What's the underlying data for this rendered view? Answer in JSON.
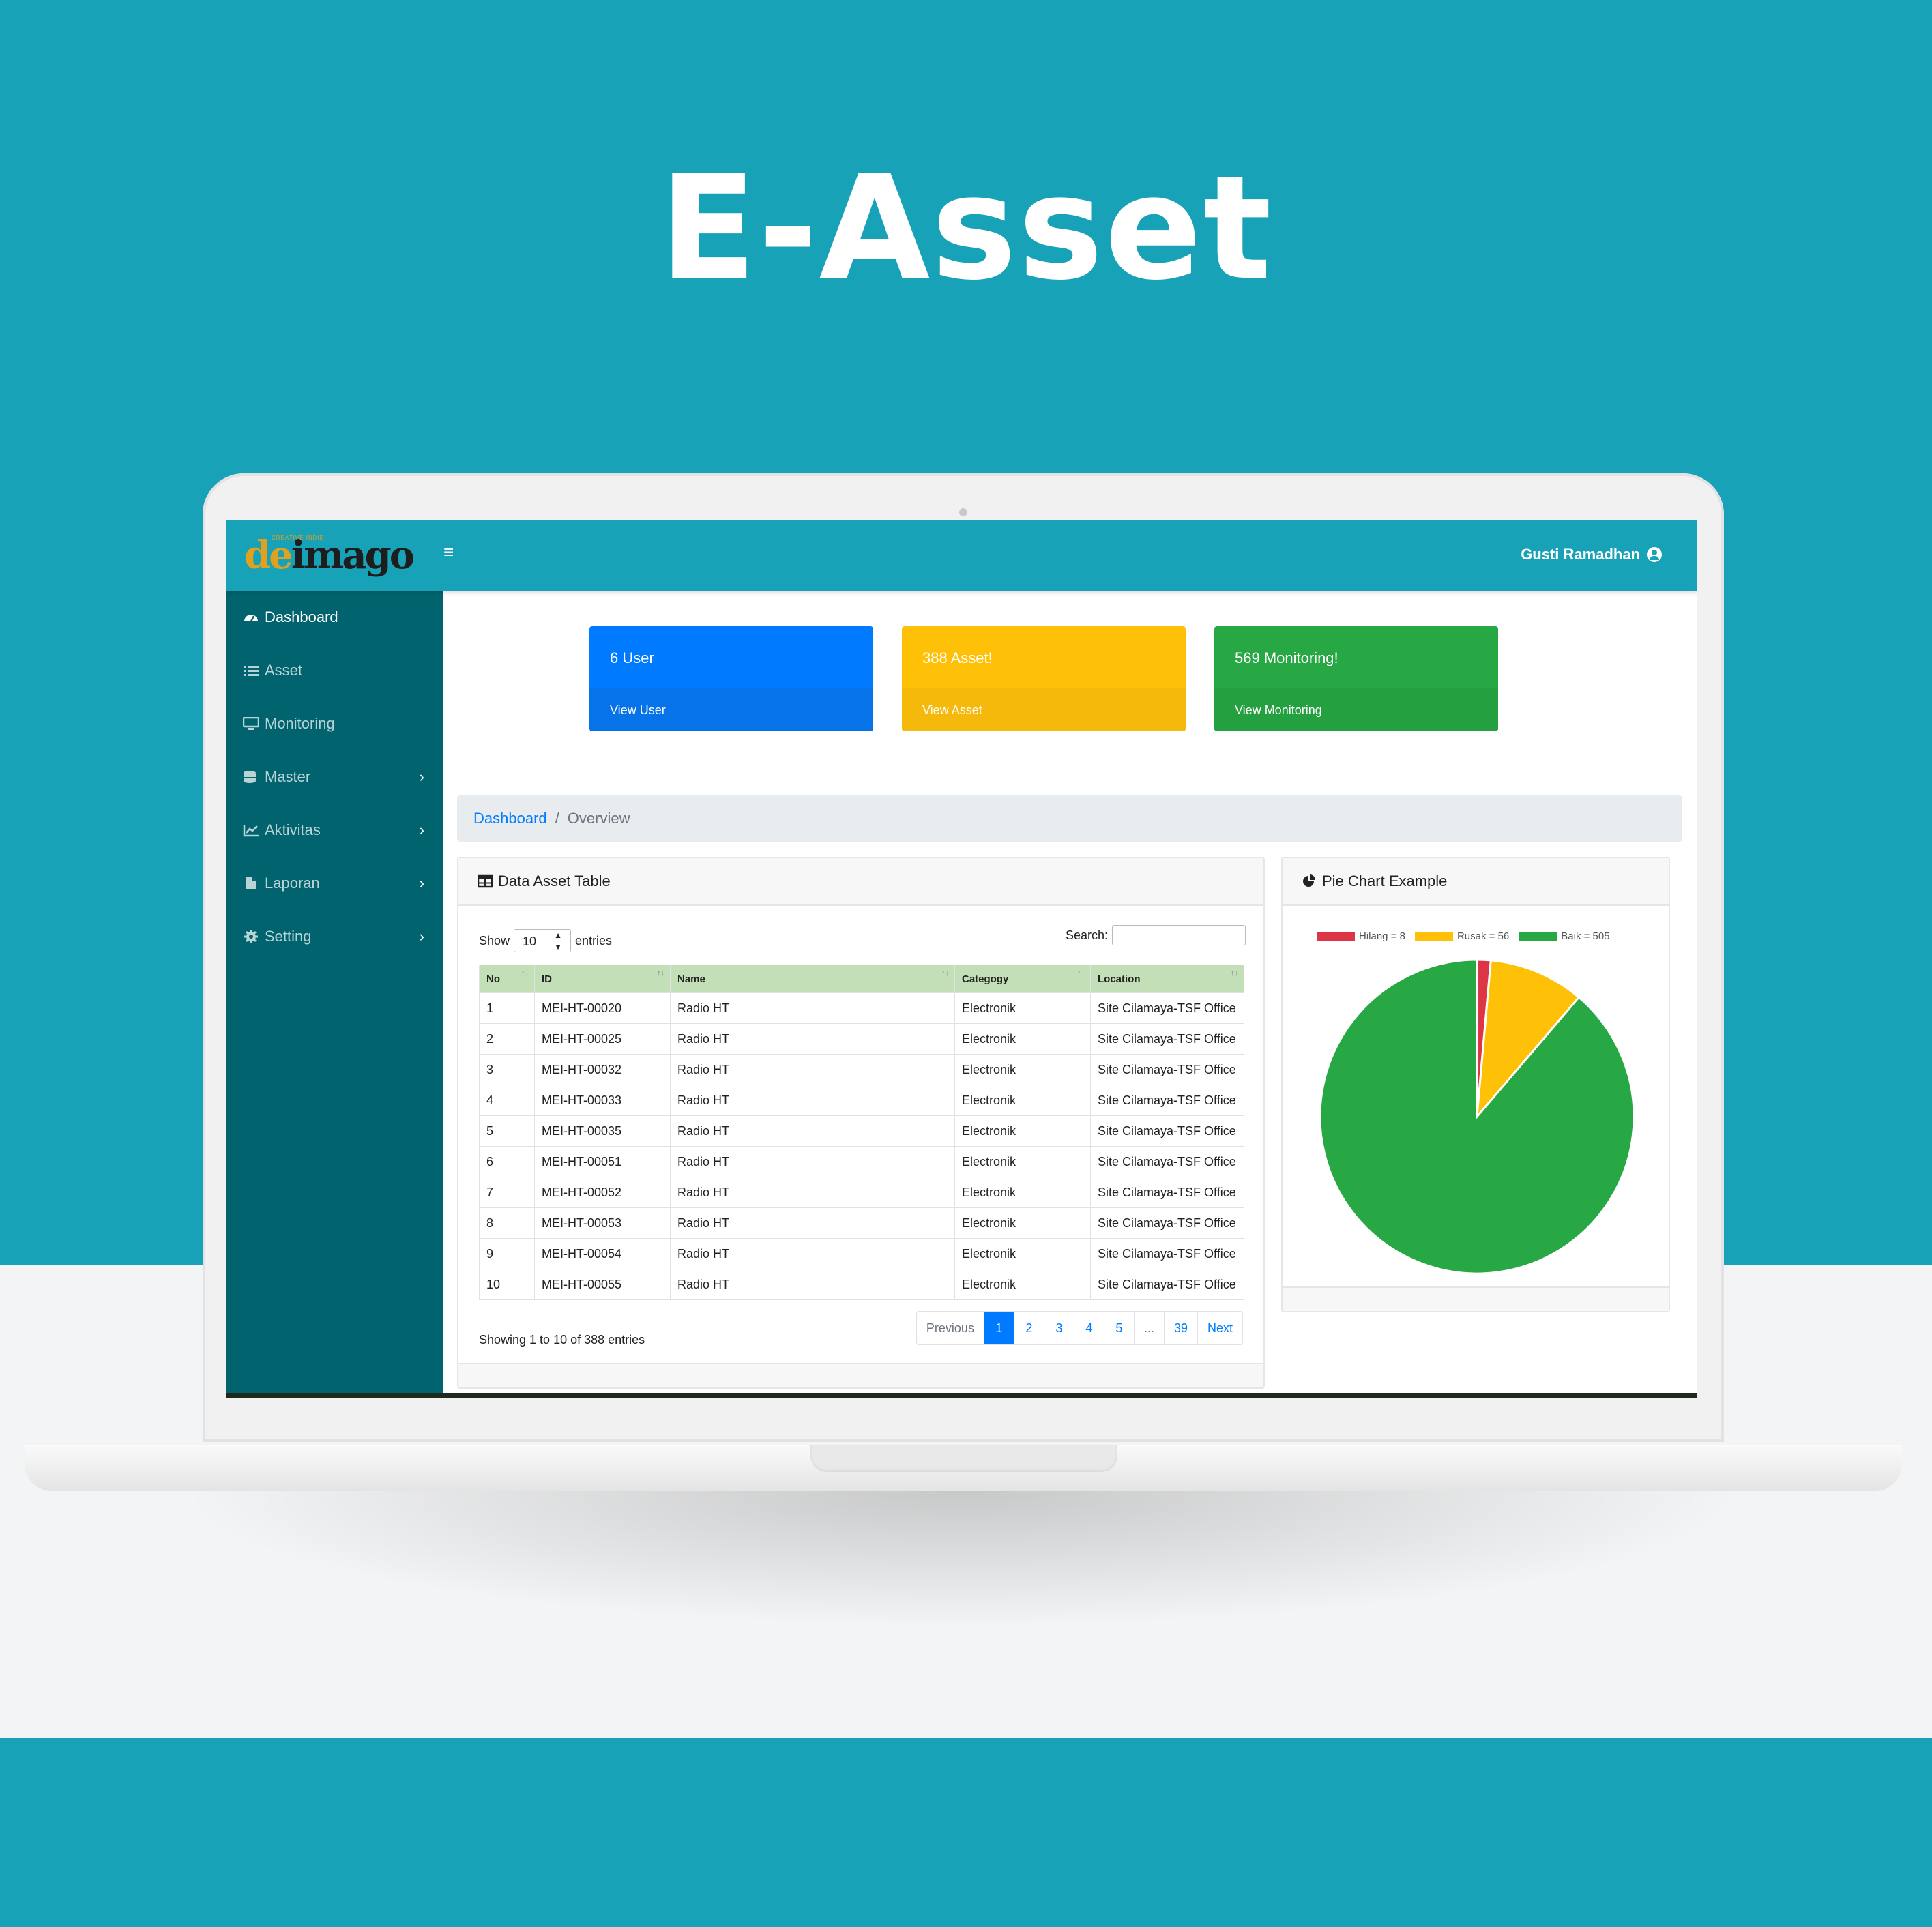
{
  "hero": {
    "title": "E-Asset"
  },
  "topbar": {
    "logo": {
      "de": "de",
      "rest": "imago",
      "tagline": "CREATIVE INDIE"
    },
    "menu_icon": "hamburger-icon",
    "user_name": "Gusti Ramadhan",
    "user_icon": "user-circle-icon"
  },
  "sidebar": {
    "items": [
      {
        "label": "Dashboard",
        "icon": "tachometer-icon",
        "active": true
      },
      {
        "label": "Asset",
        "icon": "list-icon"
      },
      {
        "label": "Monitoring",
        "icon": "desktop-icon"
      },
      {
        "label": "Master",
        "icon": "database-icon",
        "has_children": true
      },
      {
        "label": "Aktivitas",
        "icon": "line-chart-icon",
        "has_children": true
      },
      {
        "label": "Laporan",
        "icon": "file-icon",
        "has_children": true
      },
      {
        "label": "Setting",
        "icon": "gear-icon",
        "has_children": true
      }
    ]
  },
  "cards": [
    {
      "title": "6 User",
      "link": "View User",
      "color": "#007bff"
    },
    {
      "title": "388 Asset!",
      "link": "View Asset",
      "color": "#ffc107"
    },
    {
      "title": "569 Monitoring!",
      "link": "View Monitoring",
      "color": "#28a745"
    }
  ],
  "breadcrumb": {
    "link": "Dashboard",
    "separator": "/",
    "current": "Overview"
  },
  "table_card": {
    "title": "Data Asset Table",
    "icon": "table-icon",
    "show_label": "Show",
    "entries_value": "10",
    "entries_label": "entries",
    "search_label": "Search:",
    "search_value": "",
    "columns": [
      "No",
      "ID",
      "Name",
      "Categogy",
      "Location"
    ],
    "rows": [
      [
        "1",
        "MEI-HT-00020",
        "Radio HT",
        "Electronik",
        "Site Cilamaya-TSF Office"
      ],
      [
        "2",
        "MEI-HT-00025",
        "Radio HT",
        "Electronik",
        "Site Cilamaya-TSF Office"
      ],
      [
        "3",
        "MEI-HT-00032",
        "Radio HT",
        "Electronik",
        "Site Cilamaya-TSF Office"
      ],
      [
        "4",
        "MEI-HT-00033",
        "Radio HT",
        "Electronik",
        "Site Cilamaya-TSF Office"
      ],
      [
        "5",
        "MEI-HT-00035",
        "Radio HT",
        "Electronik",
        "Site Cilamaya-TSF Office"
      ],
      [
        "6",
        "MEI-HT-00051",
        "Radio HT",
        "Electronik",
        "Site Cilamaya-TSF Office"
      ],
      [
        "7",
        "MEI-HT-00052",
        "Radio HT",
        "Electronik",
        "Site Cilamaya-TSF Office"
      ],
      [
        "8",
        "MEI-HT-00053",
        "Radio HT",
        "Electronik",
        "Site Cilamaya-TSF Office"
      ],
      [
        "9",
        "MEI-HT-00054",
        "Radio HT",
        "Electronik",
        "Site Cilamaya-TSF Office"
      ],
      [
        "10",
        "MEI-HT-00055",
        "Radio HT",
        "Electronik",
        "Site Cilamaya-TSF Office"
      ]
    ],
    "info": "Showing 1 to 10 of 388 entries",
    "pagination": [
      "Previous",
      "1",
      "2",
      "3",
      "4",
      "5",
      "...",
      "39",
      "Next"
    ],
    "current_page": "1"
  },
  "pie_card": {
    "title": "Pie Chart Example",
    "icon": "pie-chart-icon"
  },
  "chart_data": {
    "type": "pie",
    "labels": [
      "Hilang = 8",
      "Rusak = 56",
      "Baik = 505"
    ],
    "values": [
      8,
      56,
      505
    ],
    "colors": [
      "#dc3545",
      "#ffc107",
      "#28a745"
    ],
    "legend": "top"
  }
}
